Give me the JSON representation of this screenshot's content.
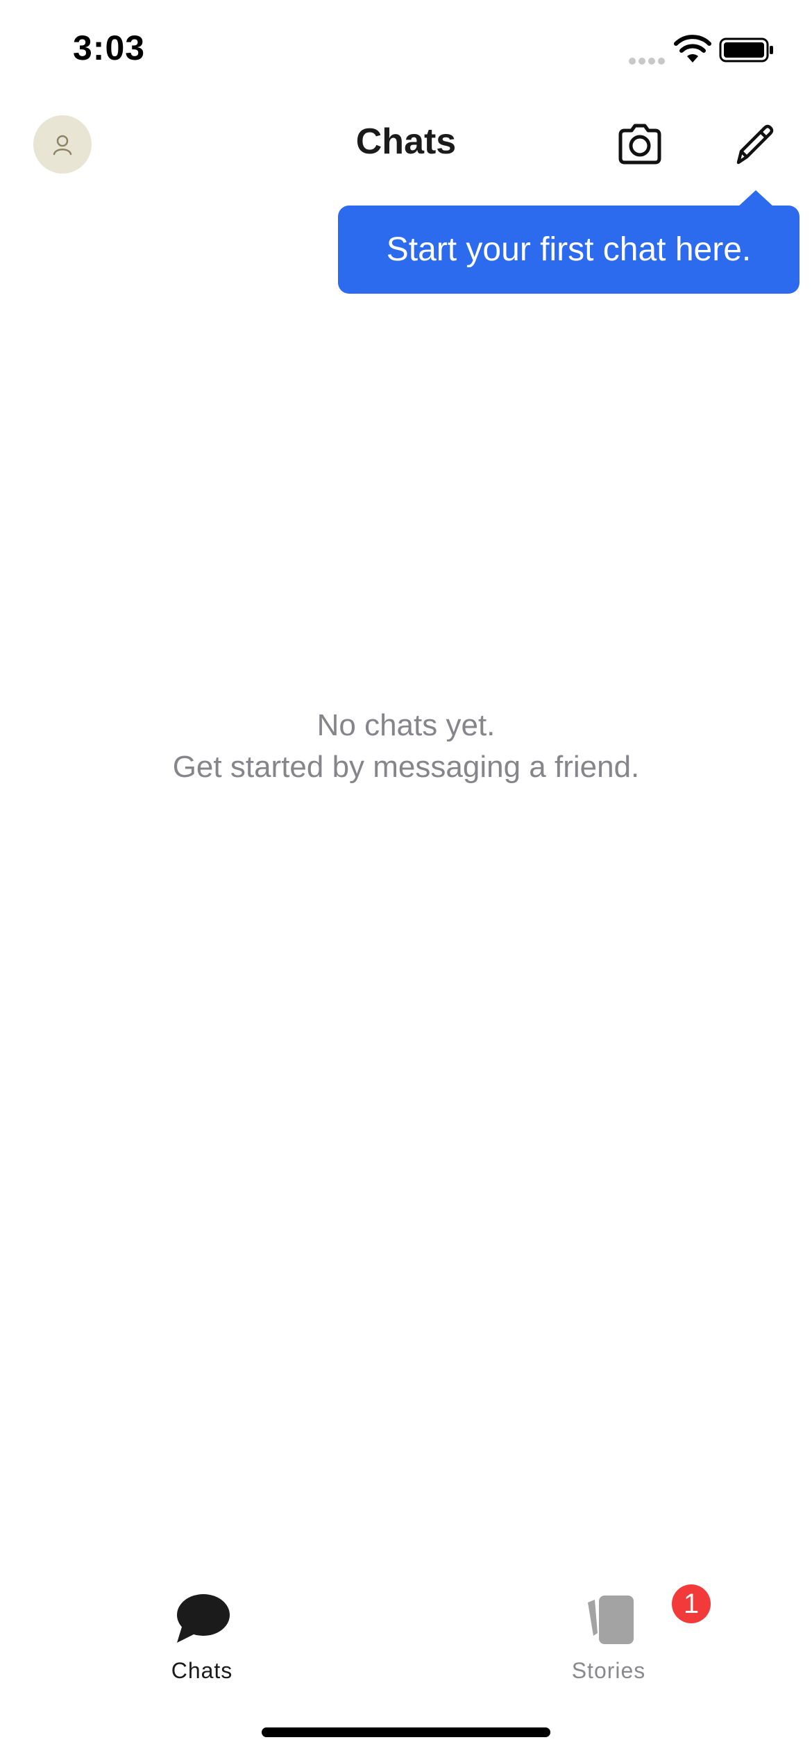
{
  "status_bar": {
    "time": "3:03",
    "signal_icon": "cellular-signal-icon",
    "wifi_icon": "wifi-icon",
    "battery_icon": "battery-icon"
  },
  "header": {
    "title": "Chats",
    "avatar_icon": "person-icon",
    "camera_icon": "camera-icon",
    "compose_icon": "pencil-icon"
  },
  "tooltip": {
    "text": "Start your first chat here."
  },
  "empty_state": {
    "line1": "No chats yet.",
    "line2": "Get started by messaging a friend."
  },
  "tab_bar": {
    "tabs": [
      {
        "label": "Chats",
        "icon": "chat-bubble-icon",
        "selected": true
      },
      {
        "label": "Stories",
        "icon": "stories-icon",
        "selected": false,
        "badge": "1"
      }
    ]
  },
  "colors": {
    "accent": "#2c6bed",
    "badge": "#f23a3a",
    "avatar_bg": "#e9e5d4",
    "secondary_text": "#86868a"
  }
}
